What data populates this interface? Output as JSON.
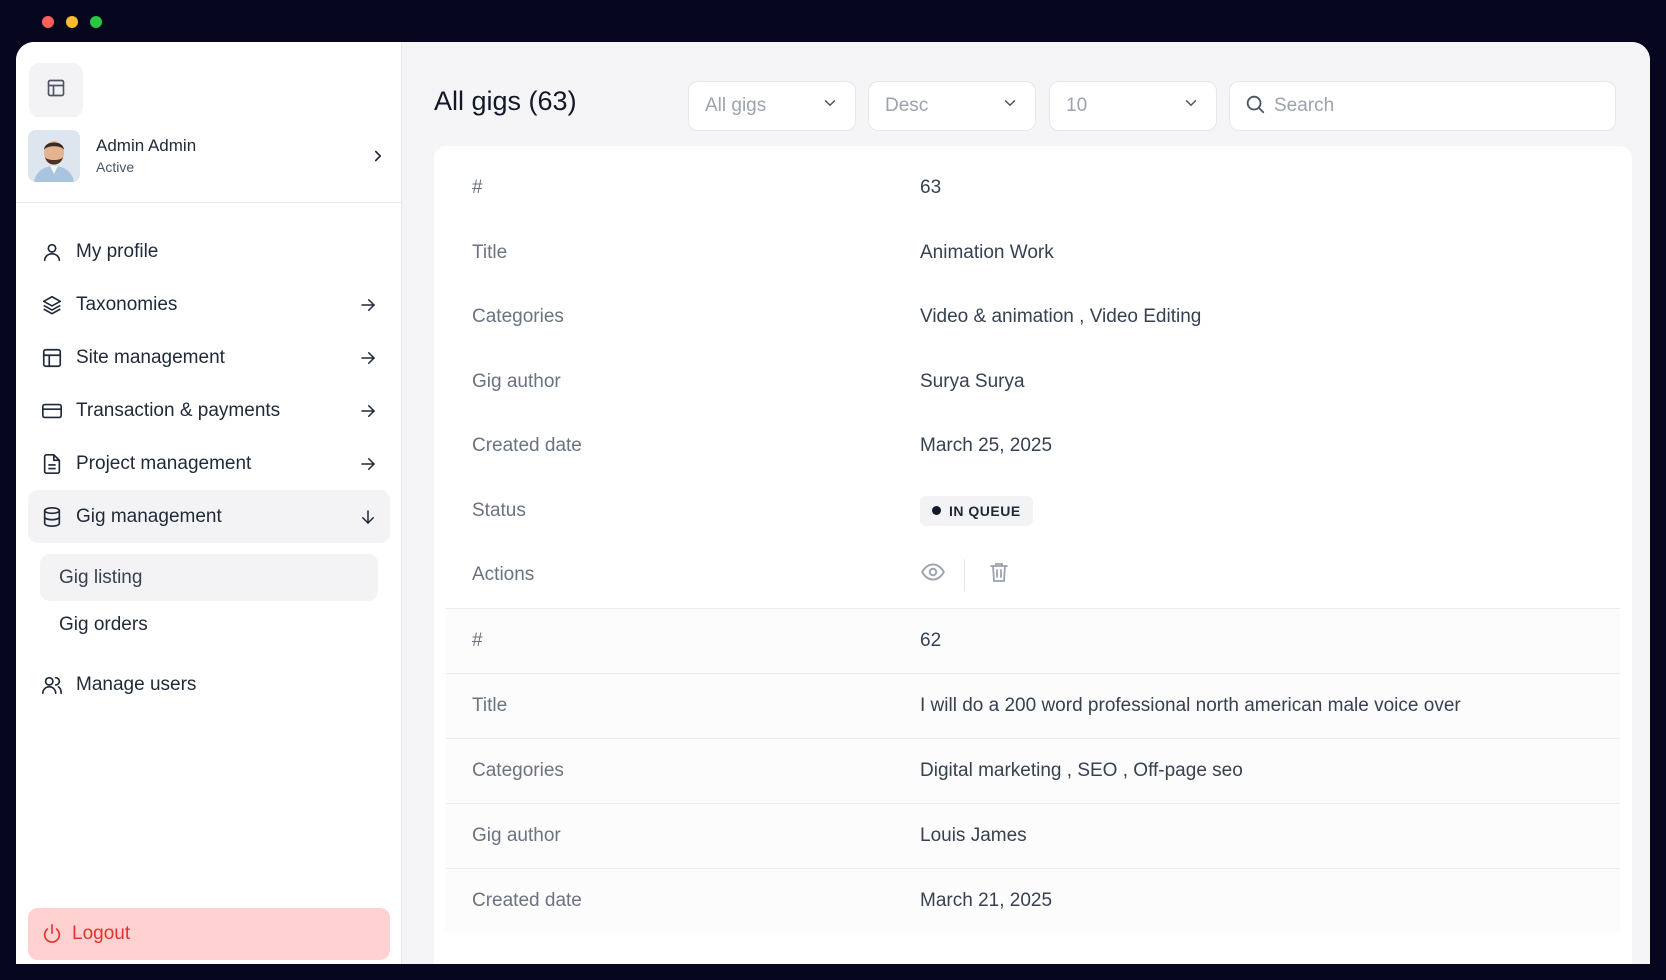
{
  "window": {
    "controls": [
      "close",
      "minimize",
      "zoom"
    ]
  },
  "sidebar": {
    "toggle_icon": "layout-icon",
    "profile": {
      "name": "Admin Admin",
      "status": "Active"
    },
    "nav": [
      {
        "label": "My profile",
        "icon": "user-icon"
      },
      {
        "label": "Taxonomies",
        "icon": "layers-icon"
      },
      {
        "label": "Site management",
        "icon": "layout-icon"
      },
      {
        "label": "Transaction & payments",
        "icon": "credit-card-icon"
      },
      {
        "label": "Project management",
        "icon": "file-text-icon"
      },
      {
        "label": "Gig management",
        "icon": "database-icon"
      }
    ],
    "sub_nav": [
      {
        "label": "Gig listing"
      },
      {
        "label": "Gig orders"
      }
    ],
    "manage_users": {
      "label": "Manage users",
      "icon": "users-icon"
    },
    "logout": {
      "label": "Logout",
      "icon": "power-icon"
    }
  },
  "main": {
    "title": "All gigs (63)",
    "filters": {
      "type": "All gigs",
      "order": "Desc",
      "per_page": "10"
    },
    "search": {
      "placeholder": "Search",
      "value": ""
    },
    "records": [
      {
        "fields": [
          {
            "key": "#",
            "value": "63"
          },
          {
            "key": "Title",
            "value": "Animation Work"
          },
          {
            "key": "Categories",
            "value": "Video & animation , Video Editing"
          },
          {
            "key": "Gig author",
            "value": "Surya Surya"
          },
          {
            "key": "Created date",
            "value": "March 25, 2025"
          }
        ],
        "status_label": "Status",
        "status": "IN QUEUE",
        "actions_label": "Actions"
      },
      {
        "fields": [
          {
            "key": "#",
            "value": "62"
          },
          {
            "key": "Title",
            "value": "I will do a 200 word professional north american male voice over"
          },
          {
            "key": "Categories",
            "value": "Digital marketing , SEO , Off-page seo"
          },
          {
            "key": "Gig author",
            "value": "Louis James"
          },
          {
            "key": "Created date",
            "value": "March 21, 2025"
          }
        ]
      }
    ]
  },
  "colors": {
    "frame": "#07061f",
    "logout_bg": "#ffd1d1",
    "logout_text": "#e0342d",
    "panel_bg": "#f5f5f7"
  }
}
